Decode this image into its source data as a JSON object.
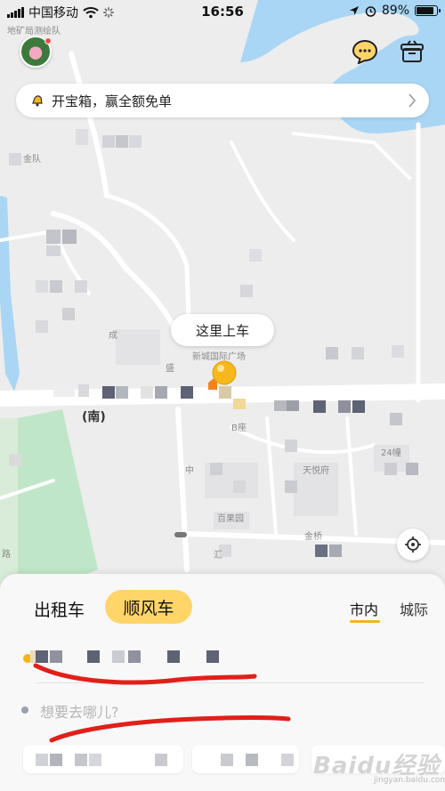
{
  "status_bar": {
    "carrier": "中国移动",
    "time": "16:56",
    "battery_text": "89%",
    "battery_level": 0.89,
    "icons": [
      "signal-icon",
      "wifi-icon",
      "loading-icon",
      "location-arrow-icon",
      "alarm-icon",
      "battery-icon"
    ]
  },
  "map": {
    "labels": [
      {
        "text": "地矿局测绘队"
      },
      {
        "text": "金队"
      },
      {
        "text": "成"
      },
      {
        "text": "新城国际广场"
      },
      {
        "text": "盛"
      },
      {
        "text": "(南)"
      },
      {
        "text": "B座"
      },
      {
        "text": "24幢"
      },
      {
        "text": "中"
      },
      {
        "text": "天悦府"
      },
      {
        "text": "百果园"
      },
      {
        "text": "汇"
      },
      {
        "text": "金桥"
      },
      {
        "text": "路"
      }
    ],
    "pickup_bubble": "这里上车"
  },
  "top": {
    "avatar_icon": "lotus-avatar",
    "chat_icon": "chat-bubble-icon",
    "treasure_icon": "gift-box-icon"
  },
  "promo": {
    "icon": "bell-icon",
    "text": "开宝箱，赢全额免单"
  },
  "panel": {
    "tabs": [
      "出租车",
      "顺风车"
    ],
    "active_tab": "顺风车",
    "sub_tabs": [
      "市内",
      "城际"
    ],
    "active_sub_tab": "市内",
    "destination_placeholder": "想要去哪儿?"
  },
  "watermark": {
    "brand": "Baidu经验",
    "sub": "jingyan.baidu.com"
  },
  "colors": {
    "accent": "#ffd56a",
    "accent_dark": "#f2b51b",
    "annotation_red": "#e0201a",
    "water": "#a9d6f4",
    "park": "#bfe6c8"
  }
}
